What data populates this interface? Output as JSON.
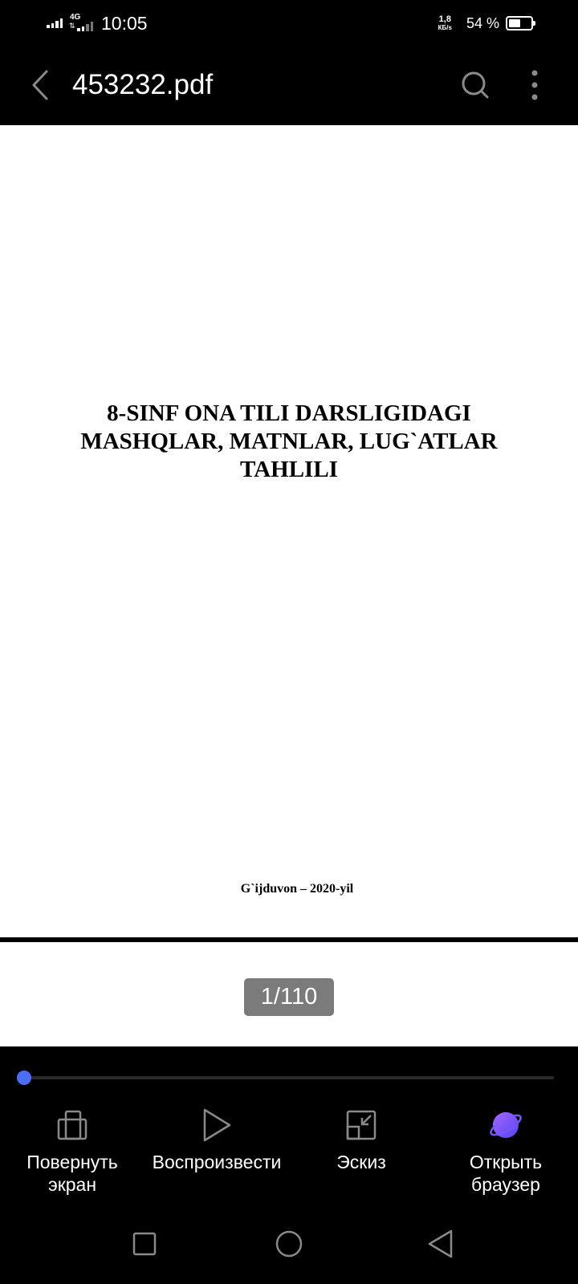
{
  "status_bar": {
    "network_type": "4G",
    "time": "10:05",
    "net_speed_value": "1,8",
    "net_speed_unit": "КБ/s",
    "battery_percent": "54 %",
    "battery_level": 0.54
  },
  "app_bar": {
    "title": "453232.pdf",
    "icons": {
      "back": "chevron-left-icon",
      "search": "search-icon",
      "more": "more-vertical-icon"
    }
  },
  "document": {
    "heading_lines": [
      "8-SINF ONA TILI DARSLIGIDAGI",
      "MASHQLAR, MATNLAR, LUG`ATLAR",
      "TAHLILI"
    ],
    "footer": "G`ijduvon – 2020-yil"
  },
  "page_indicator": "1/110",
  "progress": {
    "current_page": 1,
    "total_pages": 110
  },
  "toolbar": {
    "items": [
      {
        "label": "Повернуть\nэкран",
        "icon": "rotate-screen-icon"
      },
      {
        "label": "Воспроизвести",
        "icon": "play-icon"
      },
      {
        "label": "Эскиз",
        "icon": "thumbnail-icon"
      },
      {
        "label": "Открыть\nбраузер",
        "icon": "browser-planet-icon"
      }
    ],
    "accent_color": "#4c6ef5"
  },
  "nav_bar": {
    "icons": [
      "recent-apps-icon",
      "home-icon",
      "back-icon"
    ]
  }
}
